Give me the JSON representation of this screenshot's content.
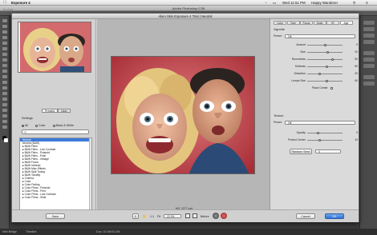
{
  "menubar": {
    "app_name": "Exposure 4",
    "apple_icon": "apple-logo",
    "clock": "Wed 11:51 PM",
    "user": "Happy Wanderer"
  },
  "photoshop": {
    "title": "Adobe Photoshop CS6",
    "status_left": "Mini Bridge",
    "status_mid": "Timeline",
    "doc_info": "Doc: 10.2M/10.2M"
  },
  "dialog": {
    "title": "Alien Skin Exposure 4 Trial | Neutral",
    "left": {
      "tabs": [
        "Presets",
        "User"
      ],
      "active_tab": 0,
      "settings_label": "Settings",
      "radios": [
        "All",
        "Color",
        "Black & White"
      ],
      "selected_radio": 0,
      "search_placeholder": "",
      "presets": [
        "Neutral",
        "Neutral (B&W)",
        "B&W Films",
        "B&W Films - Low Contrast",
        "B&W Films - Polaroid",
        "B&W Films - Push",
        "B&W Films - Vintage",
        "B&W Focus",
        "B&W Infrared",
        "B&W Misc Effects",
        "B&W Split Toning",
        "B&W Tonality",
        "Cinema",
        "Color",
        "Color Fading",
        "Color Films - Polaroid",
        "Color Films - Print",
        "Color Films - Low Contrast",
        "Color Films - Slide"
      ],
      "selected_preset": 0
    },
    "center": {
      "filename": "_MG_0277.psd"
    },
    "right": {
      "tabs": [
        "Color",
        "Tone",
        "Focus",
        "Grain",
        "IR",
        "Age"
      ],
      "active_tab": 5,
      "vignette": {
        "heading": "Vignette",
        "preset_label": "Preset:",
        "preset_value": "Off",
        "sliders": [
          {
            "label": "Amount",
            "value": "0",
            "level": 0.5
          },
          {
            "label": "Size",
            "value": "20",
            "level": 0.58
          },
          {
            "label": "Roundness",
            "value": "50",
            "level": 0.72
          },
          {
            "label": "Softness",
            "value": "50",
            "level": 0.55
          },
          {
            "label": "Distortion",
            "value": "20",
            "level": 0.35
          },
          {
            "label": "Lumps Size",
            "value": "40",
            "level": 0.55
          }
        ],
        "place_center_label": "Place Center"
      },
      "texture": {
        "heading": "Texture",
        "preset_label": "Preset:",
        "preset_value": "Off",
        "sliders": [
          {
            "label": "Opacity",
            "value": "0",
            "level": 0.3
          },
          {
            "label": "Protect Center",
            "value": "10",
            "level": 0.35
          }
        ],
        "random_seed_label": "Random Seed",
        "random_seed_value": "0"
      }
    },
    "bottom": {
      "save_label": "Save",
      "zoom_ratio": "1:1",
      "fit_label": "Fit",
      "zoom_select": "22.9%",
      "before_label": "Before",
      "cancel_label": "Cancel",
      "ok_label": "OK"
    }
  },
  "colors": {
    "accent_blue": "#3b7ad9",
    "photo_background": "#c8484f"
  }
}
